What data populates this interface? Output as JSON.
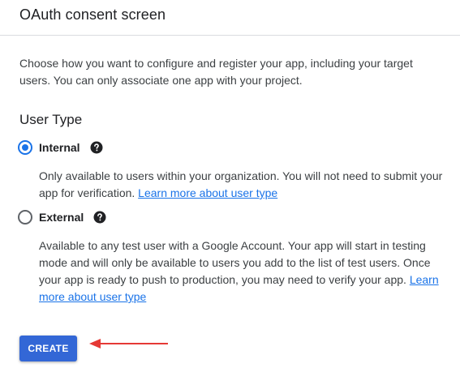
{
  "header": {
    "title": "OAuth consent screen"
  },
  "intro": "Choose how you want to configure and register your app, including your target users. You can only associate one app with your project.",
  "user_type": {
    "title": "User Type",
    "options": [
      {
        "label": "Internal",
        "selected": true,
        "help_icon": "help-circle-icon",
        "description": "Only available to users within your organization. You will not need to submit your app for verification. ",
        "link": "Learn more about user type"
      },
      {
        "label": "External",
        "selected": false,
        "help_icon": "help-circle-icon",
        "description": "Available to any test user with a Google Account. Your app will start in testing mode and will only be available to users you add to the list of test users. Once your app is ready to push to production, you may need to verify your app. ",
        "link": "Learn more about user type"
      }
    ]
  },
  "create_button": {
    "label": "CREATE"
  },
  "annotation": {
    "arrow_color": "#e53935",
    "icon": "red-arrow-left"
  },
  "colors": {
    "accent": "#1a73e8",
    "button": "#3367d6"
  }
}
